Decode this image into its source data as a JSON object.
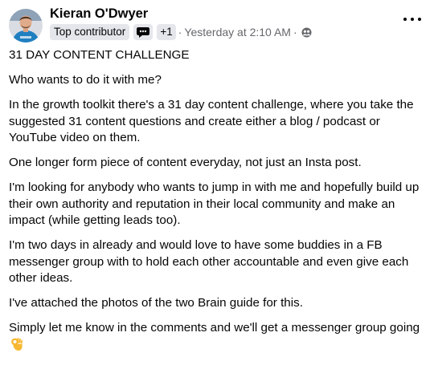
{
  "post": {
    "author": "Kieran O'Dwyer",
    "badge": "Top contributor",
    "badge_icon": "chat-bubble-icon",
    "extra_badges": "+1",
    "separator": "·",
    "timestamp": "Yesterday at 2:10 AM",
    "audience_icon": "group-icon",
    "more_icon": "ellipsis-icon",
    "paragraphs": [
      "31 DAY CONTENT CHALLENGE",
      "Who wants to do it with me?",
      "In the growth toolkit there's a 31 day content challenge, where you take the suggested 31 content questions and create either a blog / podcast or YouTube video on them.",
      "One longer form piece of content everyday, not just an Insta post.",
      "I'm looking for anybody who wants to jump in with me and hopefully build up their own authority and reputation in their local community and make an impact (while getting leads too).",
      "I'm two days in already and would love to have some buddies in a FB messenger group with to hold each other accountable and even give each other ideas.",
      "I've attached the photos of the two Brain guide for this.",
      "Simply let me know in the comments and we'll get a messenger group going"
    ],
    "trailing_emoji": "ok-hand-emoji"
  },
  "colors": {
    "text": "#050505",
    "secondary": "#65676b",
    "badge_bg": "#e4e6eb",
    "avatar_shirt": "#1f7fc1",
    "emoji": "#f7b733"
  }
}
